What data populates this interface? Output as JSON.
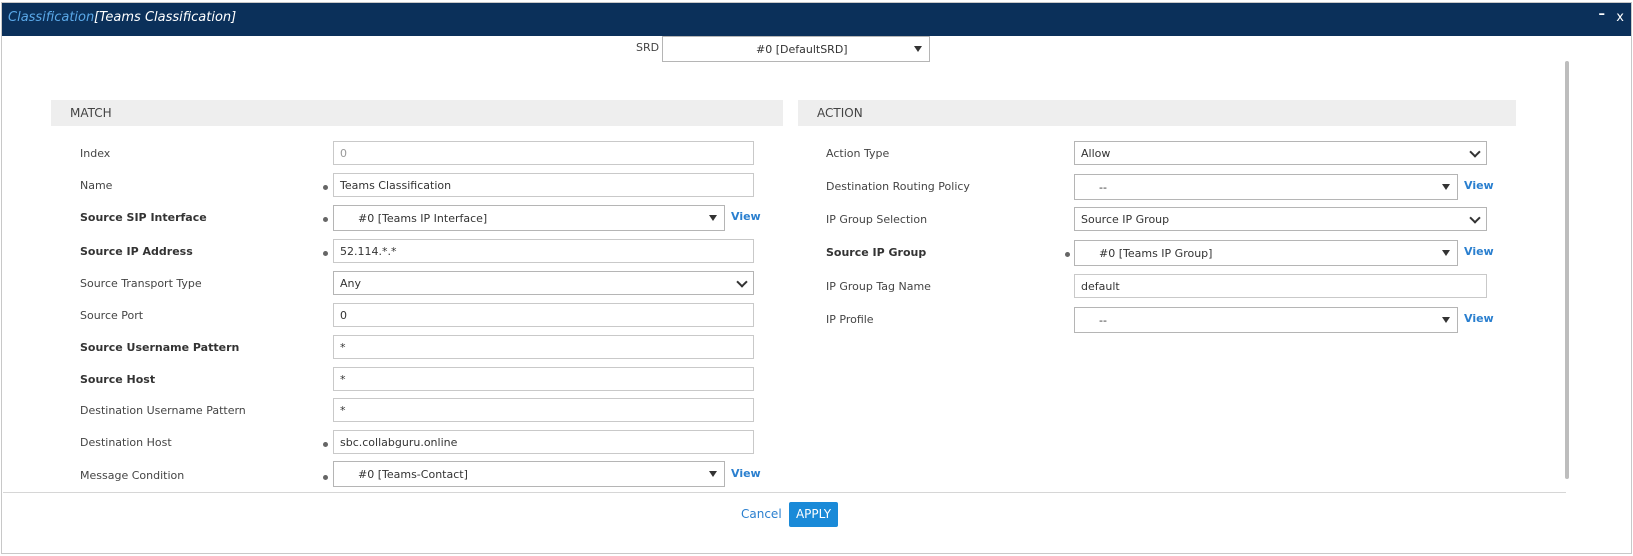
{
  "window": {
    "title": "Classification",
    "subtitle": "[Teams Classification]",
    "minimize_label": "–",
    "close_label": "x"
  },
  "srd": {
    "label": "SRD",
    "value": "#0 [DefaultSRD]"
  },
  "match": {
    "header": "MATCH",
    "index": {
      "label": "Index",
      "value": "0"
    },
    "name": {
      "label": "Name",
      "value": "Teams Classification"
    },
    "source_sip_interface": {
      "label": "Source SIP Interface",
      "value": "#0 [Teams IP Interface]",
      "view": "View"
    },
    "source_ip_address": {
      "label": "Source IP Address",
      "value": "52.114.*.*"
    },
    "source_transport_type": {
      "label": "Source Transport Type",
      "value": "Any"
    },
    "source_port": {
      "label": "Source Port",
      "value": "0"
    },
    "source_username_pattern": {
      "label": "Source Username Pattern",
      "value": "*"
    },
    "source_host": {
      "label": "Source Host",
      "value": "*"
    },
    "destination_username_pattern": {
      "label": "Destination Username Pattern",
      "value": "*"
    },
    "destination_host": {
      "label": "Destination Host",
      "value": "sbc.collabguru.online"
    },
    "message_condition": {
      "label": "Message Condition",
      "value": "#0 [Teams-Contact]",
      "view": "View"
    }
  },
  "action": {
    "header": "ACTION",
    "action_type": {
      "label": "Action Type",
      "value": "Allow"
    },
    "destination_routing_policy": {
      "label": "Destination Routing Policy",
      "value": "--",
      "view": "View"
    },
    "ip_group_selection": {
      "label": "IP Group Selection",
      "value": "Source IP Group"
    },
    "source_ip_group": {
      "label": "Source IP Group",
      "value": "#0 [Teams IP Group]",
      "view": "View"
    },
    "ip_group_tag_name": {
      "label": "IP Group Tag Name",
      "value": "default"
    },
    "ip_profile": {
      "label": "IP Profile",
      "value": "--",
      "view": "View"
    }
  },
  "footer": {
    "cancel_label": "Cancel",
    "apply_label": "APPLY"
  },
  "colors": {
    "titlebar": "#0b305a",
    "accent": "#1a8ad8",
    "link": "#2a7fcf"
  }
}
